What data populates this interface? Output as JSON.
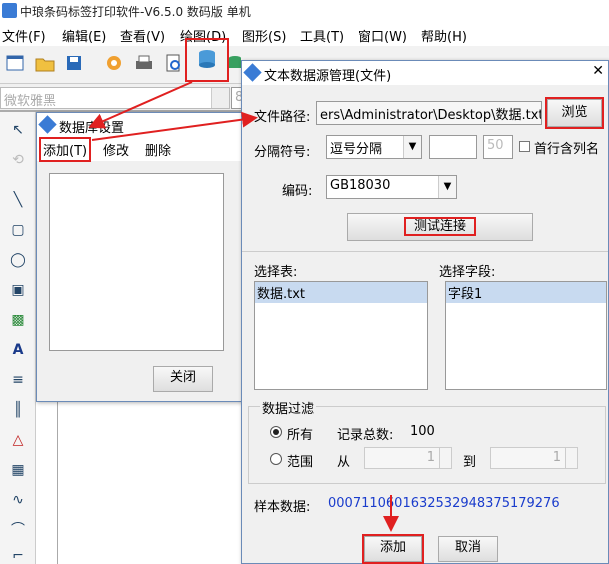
{
  "app": {
    "title": "中琅条码标签打印软件-V6.5.0 数码版 单机"
  },
  "menu": [
    "文件(F)",
    "编辑(E)",
    "查看(V)",
    "绘图(D)",
    "图形(S)",
    "工具(T)",
    "窗口(W)",
    "帮助(H)"
  ],
  "font_bar": {
    "font": "微软雅黑",
    "size": "8"
  },
  "db_dialog": {
    "title": "数据库设置",
    "menu": [
      "添加(T)",
      "修改",
      "删除"
    ],
    "close_label": "关闭"
  },
  "text_dialog": {
    "title": "文本数据源管理(文件)",
    "file_path_label": "文件路径:",
    "file_path": "ers\\Administrator\\Desktop\\数据.txt",
    "browse_label": "浏览",
    "sep_label": "分隔符号:",
    "sep_value": "逗号分隔",
    "sep_custom": "",
    "sep_num": "50",
    "first_row_label": "首行含列名",
    "encoding_label": "编码:",
    "encoding_value": "GB18030",
    "test_label": "测试连接",
    "select_table_label": "选择表:",
    "tables": [
      "数据.txt"
    ],
    "select_field_label": "选择字段:",
    "fields": [
      "字段1"
    ],
    "filter_label": "数据过滤",
    "all_label": "所有",
    "record_label": "记录总数:",
    "record_count": "100",
    "range_label": "范围",
    "from_label": "从",
    "from_value": "1",
    "to_label": "到",
    "to_value": "1",
    "sample_label": "样本数据:",
    "sample_value": "0007110601632532948375179276",
    "add_label": "添加",
    "cancel_label": "取消"
  },
  "colors": {
    "accent": "#e02020",
    "sample": "#1a3ccc"
  }
}
